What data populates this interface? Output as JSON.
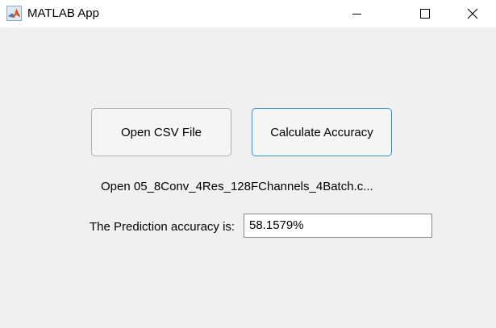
{
  "window": {
    "title": "MATLAB App",
    "icon": "matlab-logo-icon",
    "controls": [
      "minimize-icon",
      "maximize-icon",
      "close-icon"
    ]
  },
  "buttons": {
    "open_csv": "Open CSV File",
    "calculate": "Calculate Accuracy"
  },
  "file_status": "Open 05_8Conv_4Res_128FChannels_4Batch.c...",
  "accuracy": {
    "label": "The Prediction accuracy is:",
    "value": "58.1579%"
  },
  "colors": {
    "focus_border": "#2f8ee0",
    "background": "#f0f0f0"
  }
}
